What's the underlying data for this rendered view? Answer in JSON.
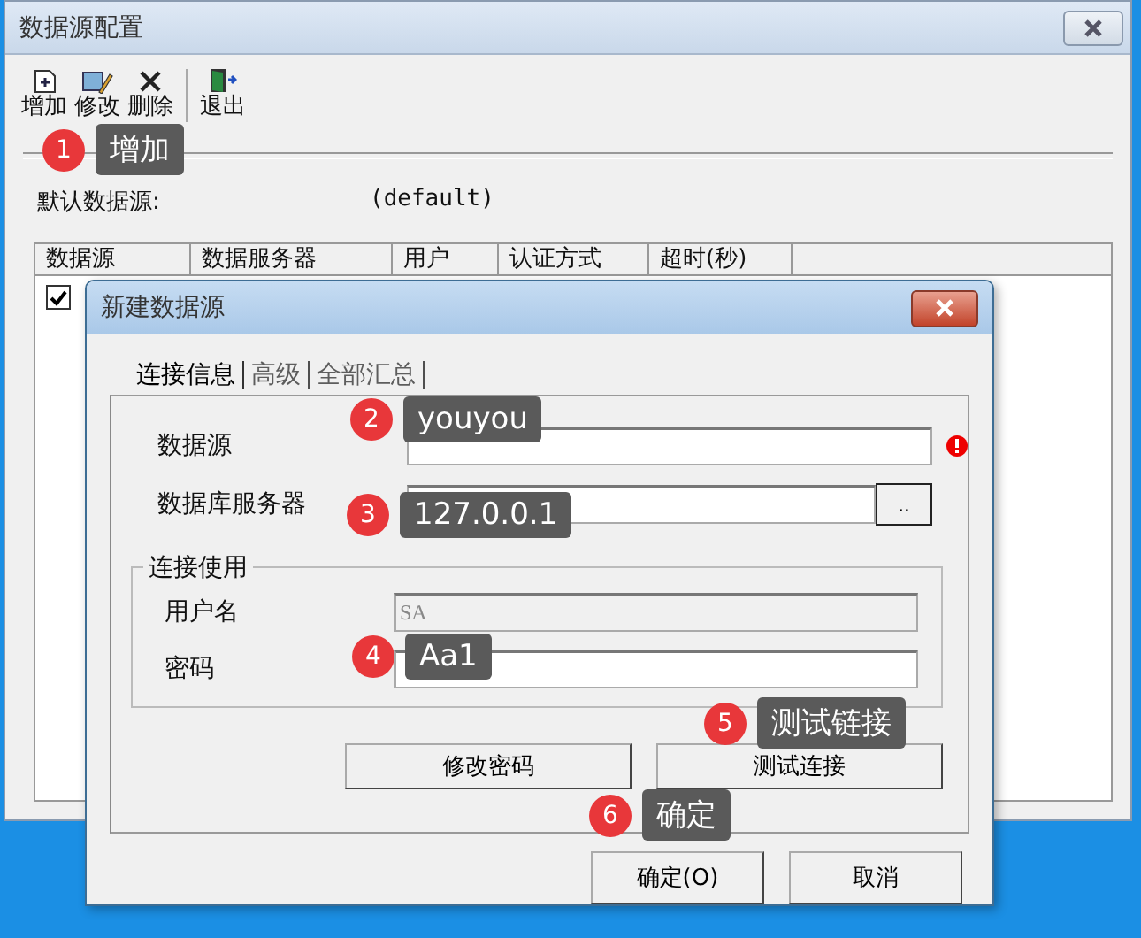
{
  "main_window": {
    "title": "数据源配置"
  },
  "toolbar": [
    {
      "kind": "add",
      "label": "增加"
    },
    {
      "kind": "edit",
      "label": "修改"
    },
    {
      "kind": "delete",
      "label": "删除"
    },
    {
      "kind": "exit",
      "label": "退出"
    }
  ],
  "default_source": {
    "label": "默认数据源:",
    "value": "(default)"
  },
  "table": {
    "columns": [
      "数据源",
      "数据服务器",
      "用户",
      "认证方式",
      "超时(秒)"
    ],
    "rows": [
      {
        "checked": true
      }
    ]
  },
  "dialog": {
    "title": "新建数据源",
    "tabs": [
      {
        "label": "连接信息",
        "selected": true
      },
      {
        "label": "高级",
        "selected": false
      },
      {
        "label": "全部汇总",
        "selected": false
      }
    ],
    "fields": [
      {
        "label": "数据源",
        "error": true
      },
      {
        "label": "数据库服务器",
        "error": false,
        "browse": ".."
      }
    ],
    "group": {
      "title": "连接使用",
      "fields": [
        {
          "label": "用户名",
          "value": "SA",
          "disabled": true
        },
        {
          "label": "密码",
          "disabled": false
        }
      ]
    },
    "buttons": [
      "修改密码",
      "测试连接"
    ],
    "footer_buttons": [
      "确定(O)",
      "取消"
    ]
  },
  "annotations": [
    {
      "number": "1",
      "text": "增加"
    },
    {
      "number": "2",
      "text": "youyou"
    },
    {
      "number": "3",
      "text": "127.0.0.1"
    },
    {
      "number": "4",
      "text": "Aa1"
    },
    {
      "number": "5",
      "text": "测试链接"
    },
    {
      "number": "6",
      "text": "确定"
    }
  ]
}
